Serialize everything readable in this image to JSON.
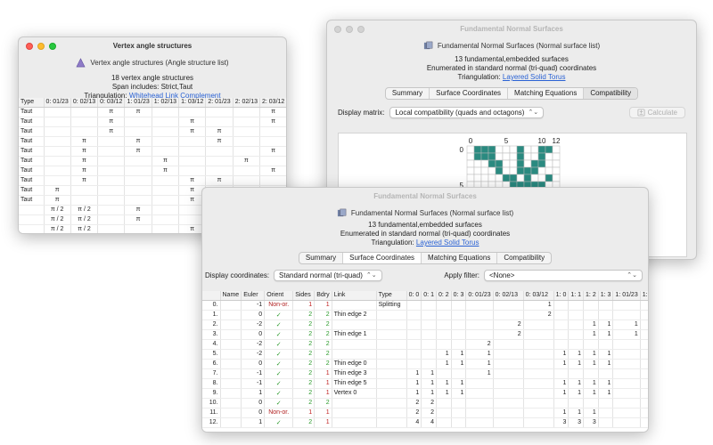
{
  "vertex_window": {
    "title": "Vertex angle structures",
    "subtitle": "Vertex angle structures (Angle structure list)",
    "info_line1": "18 vertex angle structures",
    "info_line2": "Span includes: Strict,Taut",
    "triangulation_label": "Triangulation:",
    "triangulation_link": "Whitehead Link Complement",
    "columns": [
      "Type",
      "0: 01/23",
      "0: 02/13",
      "0: 03/12",
      "1: 01/23",
      "1: 02/13",
      "1: 03/12",
      "2: 01/23",
      "2: 02/13",
      "2: 03/12",
      "3: 0"
    ],
    "rows": [
      [
        "Taut",
        "",
        "",
        "π",
        "π",
        "",
        "",
        "",
        "",
        "π",
        ""
      ],
      [
        "Taut",
        "",
        "",
        "π",
        "",
        "",
        "π",
        "",
        "",
        "π",
        ""
      ],
      [
        "Taut",
        "",
        "",
        "π",
        "",
        "",
        "π",
        "π",
        "",
        "",
        ""
      ],
      [
        "Taut",
        "",
        "π",
        "",
        "π",
        "",
        "",
        "π",
        "",
        "",
        ""
      ],
      [
        "Taut",
        "",
        "π",
        "",
        "π",
        "",
        "",
        "",
        "",
        "π",
        ""
      ],
      [
        "Taut",
        "",
        "π",
        "",
        "",
        "π",
        "",
        "",
        "π",
        "",
        ""
      ],
      [
        "Taut",
        "",
        "π",
        "",
        "",
        "π",
        "",
        "",
        "",
        "π",
        ""
      ],
      [
        "Taut",
        "",
        "π",
        "",
        "",
        "",
        "π",
        "π",
        "",
        "",
        ""
      ],
      [
        "Taut",
        "π",
        "",
        "",
        "",
        "",
        "π",
        "",
        "π",
        "",
        ""
      ],
      [
        "Taut",
        "π",
        "",
        "",
        "",
        "",
        "π",
        "",
        "",
        "π",
        ""
      ],
      [
        "",
        "π / 2",
        "π / 2",
        "",
        "π",
        "",
        "",
        "",
        "π / 2",
        "π / 2",
        ""
      ],
      [
        "",
        "π / 2",
        "π / 2",
        "",
        "π",
        "",
        "",
        "",
        "",
        "",
        ""
      ],
      [
        "",
        "π / 2",
        "π / 2",
        "",
        "",
        "",
        "π",
        "π",
        "",
        "",
        ""
      ]
    ]
  },
  "compat_window": {
    "title": "Fundamental Normal Surfaces",
    "subtitle": "Fundamental Normal Surfaces (Normal surface list)",
    "info_line1": "13 fundamental,embedded surfaces",
    "info_line2": "Enumerated in standard normal (tri-quad) coordinates",
    "triangulation_label": "Triangulation:",
    "triangulation_link": "Layered Solid Torus",
    "tabs": [
      "Summary",
      "Surface Coordinates",
      "Matching Equations",
      "Compatibility"
    ],
    "active_tab": "Compatibility",
    "display_matrix_label": "Display matrix:",
    "display_matrix_value": "Local compatibility (quads and octagons)",
    "calculate_label": "Calculate",
    "matrix_col_ticks": [
      "0",
      "5",
      "10",
      "12"
    ],
    "matrix_row_ticks": [
      "0",
      "5"
    ],
    "filled_cells": [
      [
        0,
        1
      ],
      [
        0,
        2
      ],
      [
        0,
        3
      ],
      [
        0,
        7
      ],
      [
        0,
        10
      ],
      [
        0,
        11
      ],
      [
        1,
        1
      ],
      [
        1,
        2
      ],
      [
        1,
        3
      ],
      [
        1,
        7
      ],
      [
        1,
        10
      ],
      [
        2,
        3
      ],
      [
        2,
        4
      ],
      [
        2,
        7
      ],
      [
        2,
        9
      ],
      [
        2,
        10
      ],
      [
        3,
        4
      ],
      [
        3,
        7
      ],
      [
        3,
        8
      ],
      [
        3,
        9
      ],
      [
        4,
        5
      ],
      [
        4,
        6
      ],
      [
        4,
        8
      ],
      [
        4,
        11
      ],
      [
        5,
        6
      ],
      [
        5,
        7
      ],
      [
        5,
        8
      ],
      [
        5,
        9
      ],
      [
        5,
        10
      ]
    ],
    "accent_color": "#2a8a80"
  },
  "ns_window": {
    "title": "Fundamental Normal Surfaces",
    "subtitle": "Fundamental Normal Surfaces (Normal surface list)",
    "info_line1": "13 fundamental,embedded surfaces",
    "info_line2": "Enumerated in standard normal (tri-quad) coordinates",
    "triangulation_label": "Triangulation:",
    "triangulation_link": "Layered Solid Torus",
    "tabs": [
      "Summary",
      "Surface Coordinates",
      "Matching Equations",
      "Compatibility"
    ],
    "active_tab": "Surface Coordinates",
    "display_coords_label": "Display coordinates:",
    "display_coords_value": "Standard normal (tri-quad)",
    "apply_filter_label": "Apply filter:",
    "apply_filter_value": "<None>",
    "columns": [
      "",
      "Name",
      "Euler",
      "Orient",
      "Sides",
      "Bdry",
      "Link",
      "Type",
      "0: 0",
      "0: 1",
      "0: 2",
      "0: 3",
      "0: 01/23",
      "0: 02/13",
      "0: 03/12",
      "1: 0",
      "1: 1",
      "1: 2",
      "1: 3",
      "1: 01/23",
      "1: 02/13"
    ],
    "rows": [
      [
        "0.",
        "",
        "-1",
        "Non-or.",
        "1",
        "1",
        "",
        "Splitting",
        "",
        "",
        "",
        "",
        "",
        "",
        "1",
        "",
        "",
        "",
        "",
        "",
        "1"
      ],
      [
        "1.",
        "",
        "0",
        "✓",
        "2",
        "2",
        "Thin edge 2",
        "",
        "",
        "",
        "",
        "",
        "",
        "",
        "2",
        "",
        "",
        "",
        "",
        "",
        "2"
      ],
      [
        "2.",
        "",
        "-2",
        "✓",
        "2",
        "2",
        "",
        "",
        "",
        "",
        "",
        "",
        "",
        "2",
        "",
        "",
        "",
        "1",
        "1",
        "1",
        ""
      ],
      [
        "3.",
        "",
        "0",
        "✓",
        "2",
        "2",
        "Thin edge 1",
        "",
        "",
        "",
        "",
        "",
        "",
        "2",
        "",
        "",
        "",
        "1",
        "1",
        "1",
        ""
      ],
      [
        "4.",
        "",
        "-2",
        "✓",
        "2",
        "2",
        "",
        "",
        "",
        "",
        "",
        "",
        "2",
        "",
        "",
        "",
        "",
        "",
        "",
        "",
        ""
      ],
      [
        "5.",
        "",
        "-2",
        "✓",
        "2",
        "2",
        "",
        "",
        "",
        "",
        "1",
        "1",
        "1",
        "",
        "",
        "1",
        "1",
        "1",
        "1",
        "",
        ""
      ],
      [
        "6.",
        "",
        "0",
        "✓",
        "2",
        "2",
        "Thin edge 0",
        "",
        "",
        "",
        "1",
        "1",
        "1",
        "",
        "",
        "1",
        "1",
        "1",
        "1",
        "",
        ""
      ],
      [
        "7.",
        "",
        "-1",
        "✓",
        "2",
        "1",
        "Thin edge 3",
        "",
        "1",
        "1",
        "",
        "",
        "1",
        "",
        "",
        "",
        "",
        "",
        "",
        "",
        ""
      ],
      [
        "8.",
        "",
        "-1",
        "✓",
        "2",
        "1",
        "Thin edge 5",
        "",
        "1",
        "1",
        "1",
        "1",
        "",
        "",
        "",
        "1",
        "1",
        "1",
        "1",
        "",
        ""
      ],
      [
        "9.",
        "",
        "1",
        "✓",
        "2",
        "1",
        "Vertex 0",
        "",
        "1",
        "1",
        "1",
        "1",
        "",
        "",
        "",
        "1",
        "1",
        "1",
        "1",
        "",
        ""
      ],
      [
        "10.",
        "",
        "0",
        "✓",
        "2",
        "2",
        "",
        "",
        "2",
        "2",
        "",
        "",
        "",
        "",
        "",
        "",
        "",
        "",
        "",
        "",
        ""
      ],
      [
        "11.",
        "",
        "0",
        "Non-or.",
        "1",
        "1",
        "",
        "",
        "2",
        "2",
        "",
        "",
        "",
        "",
        "",
        "1",
        "1",
        "1",
        "",
        "",
        ""
      ],
      [
        "12.",
        "",
        "1",
        "✓",
        "2",
        "1",
        "",
        "",
        "4",
        "4",
        "",
        "",
        "",
        "",
        "",
        "3",
        "3",
        "3",
        "",
        "",
        ""
      ]
    ]
  }
}
